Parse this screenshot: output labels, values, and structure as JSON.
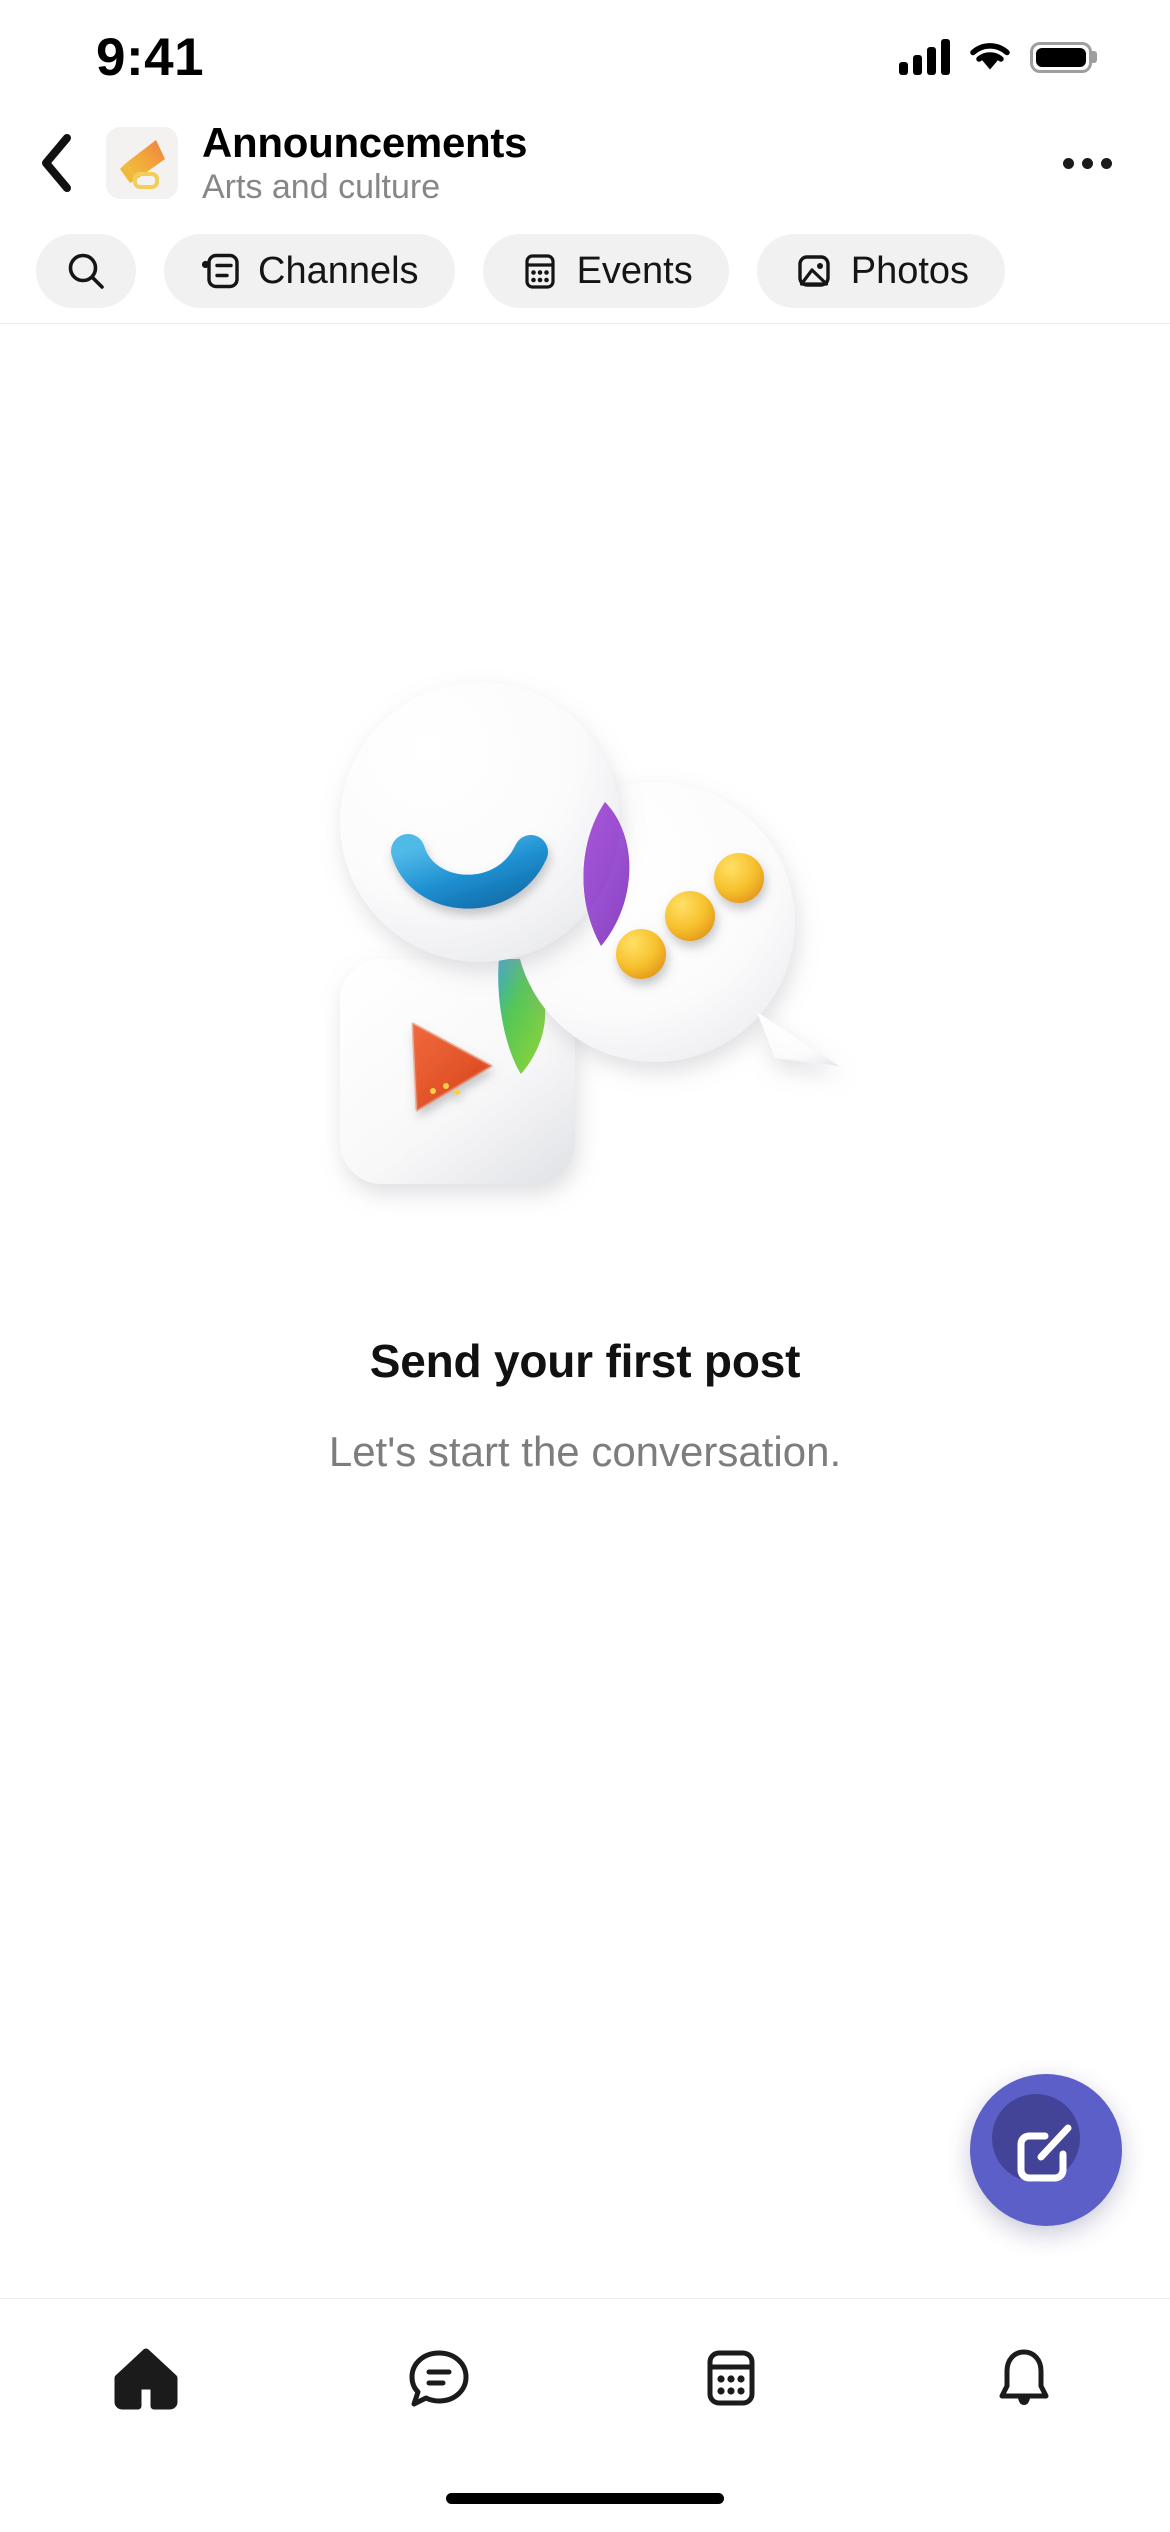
{
  "status_bar": {
    "time": "9:41",
    "signal_icon": "cellular-signal-icon",
    "wifi_icon": "wifi-icon",
    "battery_icon": "battery-full-icon"
  },
  "header": {
    "back_icon": "chevron-left-icon",
    "avatar_icon": "megaphone-icon",
    "title": "Announcements",
    "subtitle": "Arts and culture",
    "more_icon": "more-options-icon"
  },
  "tabs": [
    {
      "label": "",
      "icon": "search-icon",
      "icon_only": true
    },
    {
      "label": "Channels",
      "icon": "channels-list-icon",
      "icon_only": false
    },
    {
      "label": "Events",
      "icon": "calendar-icon",
      "icon_only": false
    },
    {
      "label": "Photos",
      "icon": "image-icon",
      "icon_only": false
    }
  ],
  "empty_state": {
    "illustration_name": "empty-posts-illustration",
    "title": "Send your first post",
    "subtitle": "Let's start the conversation."
  },
  "fab": {
    "icon": "compose-icon",
    "color": "#5B5FC7"
  },
  "bottom_nav": [
    {
      "icon": "home-icon",
      "active": true
    },
    {
      "icon": "chat-icon",
      "active": false
    },
    {
      "icon": "calendar-icon",
      "active": false
    },
    {
      "icon": "bell-icon",
      "active": false
    }
  ],
  "colors": {
    "accent": "#5B5FC7",
    "pill_bg": "#F1F1F1",
    "avatar_bg": "#F3F2F1",
    "title_text": "#111111",
    "subtle_text": "#7D7D7D",
    "header_sub_text": "#878787",
    "divider": "#ECECEC"
  }
}
